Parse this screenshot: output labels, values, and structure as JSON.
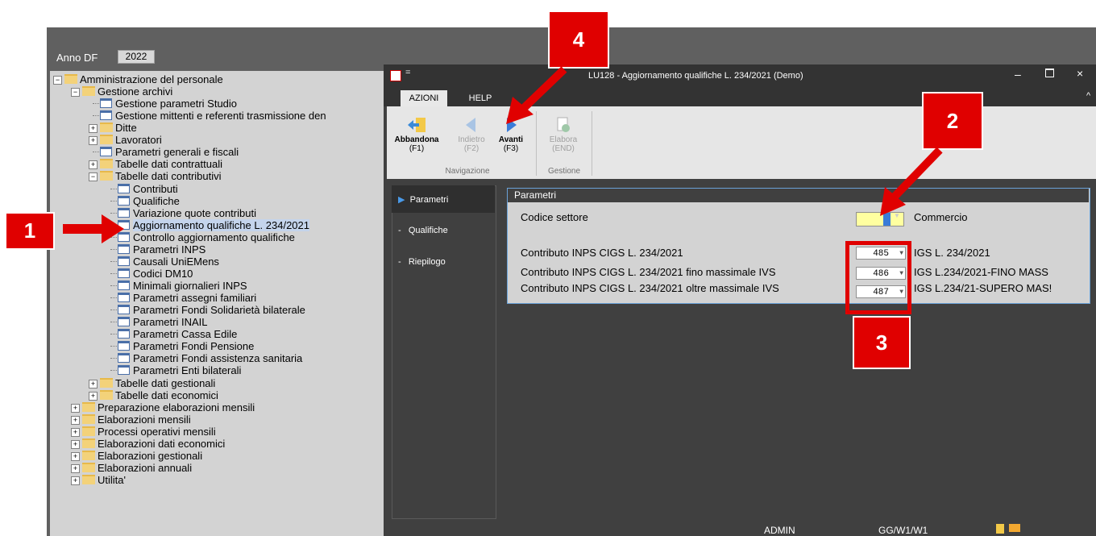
{
  "anno": {
    "label": "Anno DF",
    "value": "2022"
  },
  "tree": [
    {
      "level": 0,
      "type": "folder",
      "exp": "−",
      "label": "Amministrazione del personale"
    },
    {
      "level": 1,
      "type": "folder",
      "exp": "−",
      "label": "Gestione archivi"
    },
    {
      "level": 2,
      "type": "doc",
      "label": "Gestione parametri Studio"
    },
    {
      "level": 2,
      "type": "doc",
      "label": "Gestione mittenti e referenti trasmissione den"
    },
    {
      "level": 2,
      "type": "folder",
      "exp": "+",
      "label": "Ditte"
    },
    {
      "level": 2,
      "type": "folder",
      "exp": "+",
      "label": "Lavoratori"
    },
    {
      "level": 2,
      "type": "doc",
      "label": "Parametri generali e fiscali"
    },
    {
      "level": 2,
      "type": "folder",
      "exp": "+",
      "label": "Tabelle dati contrattuali"
    },
    {
      "level": 2,
      "type": "folder",
      "exp": "−",
      "label": "Tabelle dati contributivi"
    },
    {
      "level": 3,
      "type": "doc",
      "label": "Contributi"
    },
    {
      "level": 3,
      "type": "doc",
      "label": "Qualifiche"
    },
    {
      "level": 3,
      "type": "doc",
      "label": "Variazione quote contributi"
    },
    {
      "level": 3,
      "type": "doc",
      "label": "Aggiornamento qualifiche L. 234/2021",
      "selected": true
    },
    {
      "level": 3,
      "type": "doc",
      "label": "Controllo aggiornamento qualifiche"
    },
    {
      "level": 3,
      "type": "doc",
      "label": "Parametri INPS"
    },
    {
      "level": 3,
      "type": "doc",
      "label": "Causali UniEMens"
    },
    {
      "level": 3,
      "type": "doc",
      "label": "Codici DM10"
    },
    {
      "level": 3,
      "type": "doc",
      "label": "Minimali giornalieri INPS"
    },
    {
      "level": 3,
      "type": "doc",
      "label": "Parametri assegni familiari"
    },
    {
      "level": 3,
      "type": "doc",
      "label": "Parametri Fondi Solidarietà bilaterale"
    },
    {
      "level": 3,
      "type": "doc",
      "label": "Parametri INAIL"
    },
    {
      "level": 3,
      "type": "doc",
      "label": "Parametri Cassa Edile"
    },
    {
      "level": 3,
      "type": "doc",
      "label": "Parametri Fondi Pensione"
    },
    {
      "level": 3,
      "type": "doc",
      "label": "Parametri Fondi assistenza sanitaria"
    },
    {
      "level": 3,
      "type": "doc",
      "label": "Parametri Enti bilaterali"
    },
    {
      "level": 2,
      "type": "folder",
      "exp": "+",
      "label": "Tabelle dati gestionali"
    },
    {
      "level": 2,
      "type": "folder",
      "exp": "+",
      "label": "Tabelle dati economici"
    },
    {
      "level": 1,
      "type": "folder",
      "exp": "+",
      "label": "Preparazione elaborazioni mensili"
    },
    {
      "level": 1,
      "type": "folder",
      "exp": "+",
      "label": "Elaborazioni mensili"
    },
    {
      "level": 1,
      "type": "folder",
      "exp": "+",
      "label": "Processi operativi mensili"
    },
    {
      "level": 1,
      "type": "folder",
      "exp": "+",
      "label": "Elaborazioni dati economici"
    },
    {
      "level": 1,
      "type": "folder",
      "exp": "+",
      "label": "Elaborazioni gestionali"
    },
    {
      "level": 1,
      "type": "folder",
      "exp": "+",
      "label": "Elaborazioni annuali"
    },
    {
      "level": 1,
      "type": "folder",
      "exp": "+",
      "label": "Utilita'"
    }
  ],
  "window": {
    "title": "LU128 - Aggiornamento qualifiche L. 234/2021  (Demo)",
    "qat": "=",
    "min": "–",
    "close": "×",
    "ribbon_caret": "^"
  },
  "ribbon": {
    "tabs": [
      "AZIONI",
      "HELP"
    ],
    "buttons": [
      {
        "label": "Abbandona",
        "key": "(F1)"
      },
      {
        "label": "Indietro",
        "key": "(F2)"
      },
      {
        "label": "Avanti",
        "key": "(F3)"
      },
      {
        "label": "Elabora",
        "key": "(END)"
      }
    ],
    "groups": [
      "Navigazione",
      "Gestione"
    ]
  },
  "nav": [
    "Parametri",
    "Qualifiche",
    "Riepilogo"
  ],
  "params": {
    "header": "Parametri",
    "codice_label": "Codice settore",
    "codice_desc": "Commercio",
    "rows": [
      {
        "label": "Contributo INPS CIGS L. 234/2021",
        "code": "485",
        "desc": "IGS L. 234/2021"
      },
      {
        "label": "Contributo INPS CIGS L. 234/2021 fino massimale IVS",
        "code": "486",
        "desc": "IGS L.234/2021-FINO MASS"
      },
      {
        "label": "Contributo INPS CIGS L. 234/2021 oltre massimale IVS",
        "code": "487",
        "desc": "IGS L.234/21-SUPERO MAS!"
      }
    ]
  },
  "status": {
    "user": "ADMIN",
    "code": "GG/W1/W1"
  },
  "callouts": [
    "1",
    "2",
    "3",
    "4"
  ],
  "colors": {
    "callout": "#e00000",
    "accent": "#3a7cd8"
  }
}
